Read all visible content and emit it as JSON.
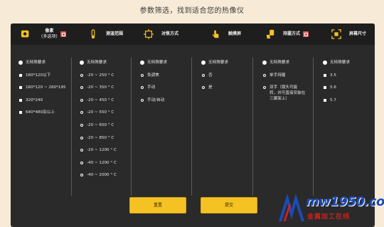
{
  "page_title": "参数筛选，找到适合您的热像仪",
  "headers": [
    {
      "icon": "pixel-icon",
      "label": "像素",
      "sub": "(多选项)"
    },
    {
      "icon": "thermometer-icon",
      "label": "测温范围",
      "sub": ""
    },
    {
      "icon": "focus-icon",
      "label": "对焦方式",
      "sub": ""
    },
    {
      "icon": "touch-icon",
      "label": "触摸屏",
      "sub": ""
    },
    {
      "icon": "handheld-icon",
      "label": "持握方式",
      "sub": ""
    },
    {
      "icon": "screen-size-icon",
      "label": "屏幕尺寸",
      "sub": ""
    }
  ],
  "columns": [
    {
      "options": [
        "无特殊要求",
        "160*120以下",
        "160*120 ~ 260*195",
        "320*240",
        "640*480及以上"
      ]
    },
    {
      "options": [
        "无特殊要求",
        "-20 ~ 250 ° C",
        "-20 ~ 350 ° C",
        "-20 ~ 450 ° C",
        "-20 ~ 550 ° C",
        "-20 ~ 650 ° C",
        "-20 ~ 850 ° C",
        "-20 ~ 1200 ° C",
        "-40 ~ 1200 ° C",
        "-40 ~ 2000 ° C"
      ]
    },
    {
      "options": [
        "无特殊要求",
        "免调焦",
        "手动",
        "手动/自动"
      ]
    },
    {
      "options": [
        "无特殊要求",
        "否",
        "是"
      ]
    },
    {
      "options": [
        "无特殊要求",
        "单手持握",
        "双手（镜头可旋",
        "转，并可直接安装在",
        "三脚架上）"
      ]
    },
    {
      "options": [
        "无特殊要求",
        "3.5",
        "5.6",
        "5.7"
      ]
    }
  ],
  "buttons": {
    "reset": "重置",
    "submit": "提交"
  },
  "watermark": {
    "text": "mw1950.com",
    "sub": "金属加工在线"
  },
  "colors": {
    "accent": "#f5c224",
    "panel": "#2a2a2a",
    "background": "#f7ead6"
  }
}
